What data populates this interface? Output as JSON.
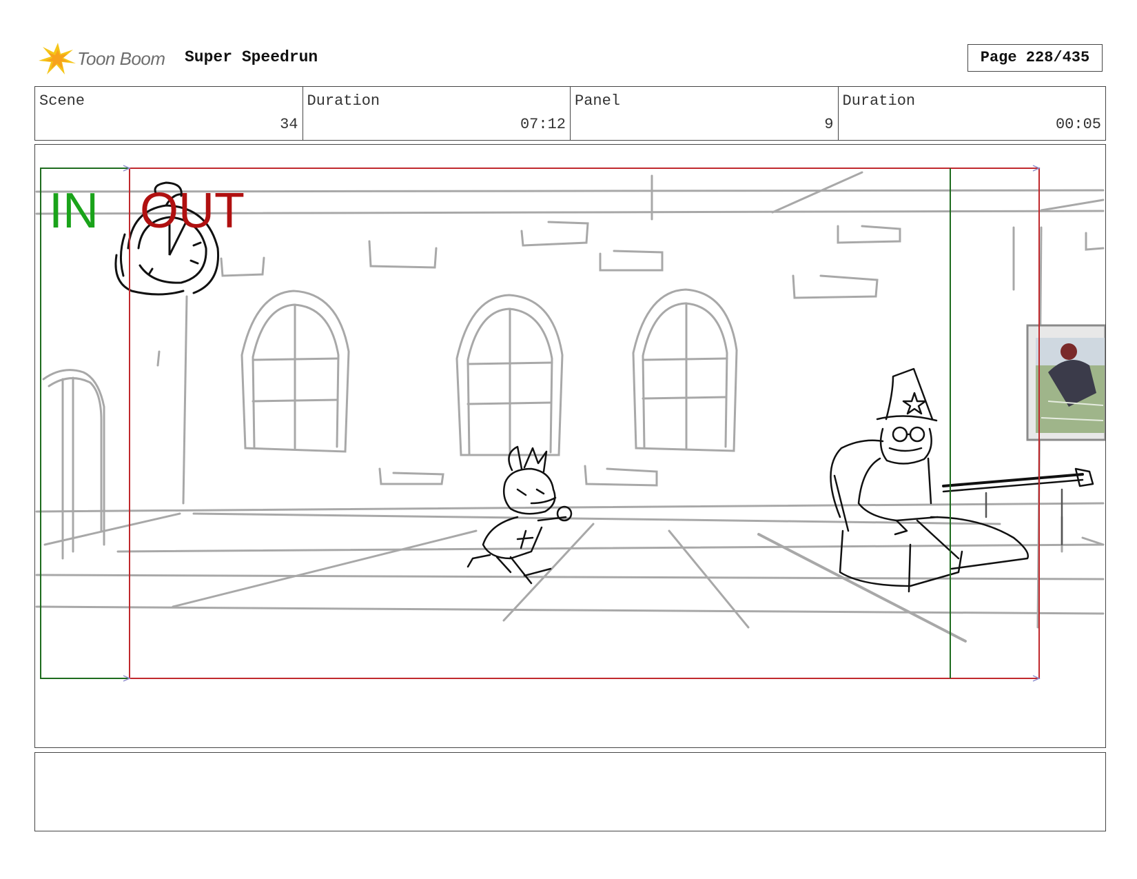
{
  "header": {
    "logo_text": "Toon Boom",
    "project_title": "Super Speedrun",
    "page_label": "Page 228/435"
  },
  "info": {
    "scene_label": "Scene",
    "scene_value": "34",
    "scene_duration_label": "Duration",
    "scene_duration_value": "07:12",
    "panel_label": "Panel",
    "panel_value": "9",
    "panel_duration_label": "Duration",
    "panel_duration_value": "00:05"
  },
  "panel": {
    "in_label": "IN",
    "out_label": "OUT",
    "in_color": "#1aa31a",
    "out_color": "#b01010",
    "safe_frame_color": "#c0282c",
    "title_safe_color": "#1d6b1d"
  },
  "notes": {
    "text": ""
  }
}
